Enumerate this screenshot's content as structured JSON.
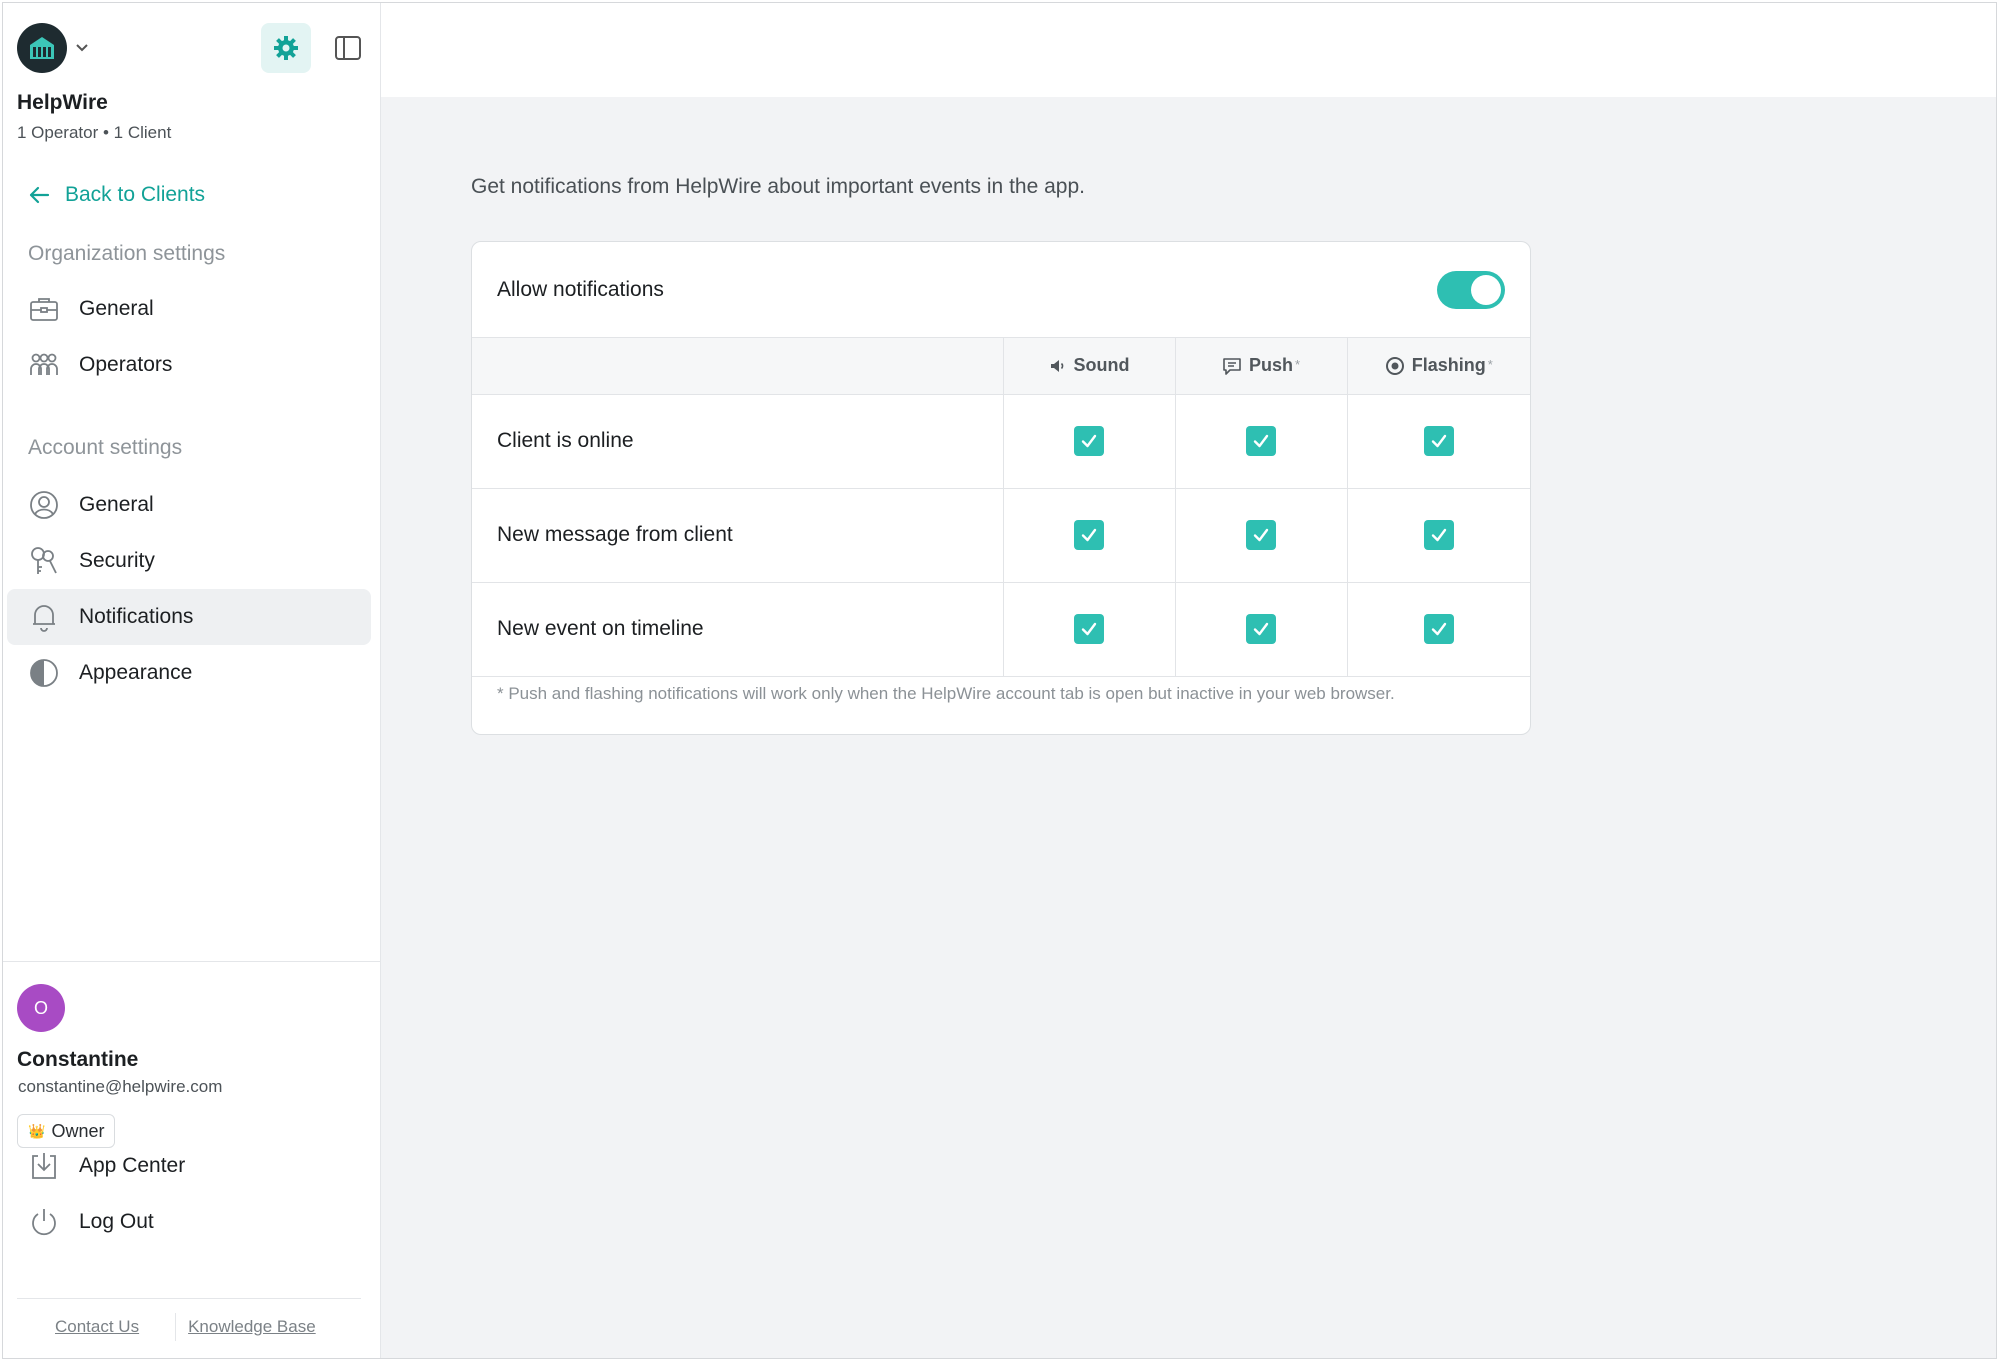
{
  "app": {
    "org_name": "HelpWire",
    "org_meta": "1 Operator • 1 Client"
  },
  "sidebar": {
    "back_label": "Back to Clients",
    "org_section": "Organization settings",
    "org_items": [
      {
        "label": "General",
        "icon": "briefcase-icon"
      },
      {
        "label": "Operators",
        "icon": "users-icon"
      }
    ],
    "account_section": "Account settings",
    "account_items": [
      {
        "label": "General",
        "icon": "user-circle-icon"
      },
      {
        "label": "Security",
        "icon": "keys-icon"
      },
      {
        "label": "Notifications",
        "icon": "bell-icon",
        "active": true
      },
      {
        "label": "Appearance",
        "icon": "contrast-icon"
      }
    ],
    "user": {
      "initial": "O",
      "name": "Constantine",
      "email": "constantine@helpwire.com",
      "role": "Owner",
      "role_emoji": "👑"
    },
    "bottom_items": [
      {
        "label": "App Center",
        "icon": "download-icon"
      },
      {
        "label": "Log Out",
        "icon": "power-icon"
      }
    ],
    "footer_links": [
      "Contact Us",
      "Knowledge Base"
    ]
  },
  "main": {
    "intro": "Get notifications from HelpWire about important events in the app.",
    "card": {
      "title": "Allow notifications",
      "allow_enabled": true,
      "columns": [
        {
          "label": "Sound",
          "icon": "speaker-icon",
          "asterisk": ""
        },
        {
          "label": "Push",
          "icon": "message-icon",
          "asterisk": "*"
        },
        {
          "label": "Flashing",
          "icon": "record-icon",
          "asterisk": "*"
        }
      ],
      "rows": [
        {
          "label": "Client is online",
          "sound": true,
          "push": true,
          "flashing": true
        },
        {
          "label": "New message from client",
          "sound": true,
          "push": true,
          "flashing": true
        },
        {
          "label": "New event on timeline",
          "sound": true,
          "push": true,
          "flashing": true
        }
      ],
      "note": "* Push and flashing notifications will work only when the HelpWire account tab is open but inactive in your web browser."
    }
  },
  "colors": {
    "accent": "#2ebfb2",
    "link": "#12a297",
    "avatar": "#a84bc4"
  }
}
